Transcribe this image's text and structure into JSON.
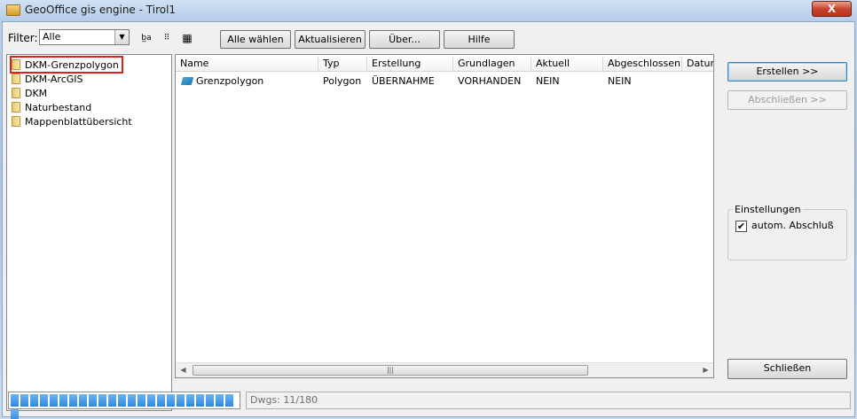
{
  "window": {
    "title": "GeoOffice gis engine - Tirol1",
    "close_label": "X"
  },
  "toolbar": {
    "filter_label": "Filter:",
    "filter_value": "Alle",
    "icon1": "b̲a",
    "icon2": "⠿",
    "icon3": "▦",
    "buttons": [
      "Alle wählen",
      "Aktualisieren",
      "Über...",
      "Hilfe"
    ]
  },
  "tree": {
    "items": [
      "DKM-Grenzpolygon",
      "DKM-ArcGIS",
      "DKM",
      "Naturbestand",
      "Mappenblattübersicht"
    ],
    "selected_index": 0
  },
  "list": {
    "columns": [
      "Name",
      "Typ",
      "Erstellung",
      "Grundlagen",
      "Aktuell",
      "Abgeschlossen",
      "Datum"
    ],
    "rows": [
      [
        "Grenzpolygon",
        "Polygon",
        "ÜBERNAHME",
        "VORHANDEN",
        "NEIN",
        "NEIN",
        ""
      ]
    ]
  },
  "right_panel": {
    "create_label": "Erstellen >>",
    "finish_label": "Abschließen >>",
    "settings_title": "Einstellungen",
    "auto_finish_label": "autom. Abschluß",
    "auto_finish_checked": true,
    "close_label": "Schließen"
  },
  "status": {
    "progress_segments": 24,
    "progress_fraction": 1.0,
    "dwgs_text": "Dwgs: 11/180"
  }
}
